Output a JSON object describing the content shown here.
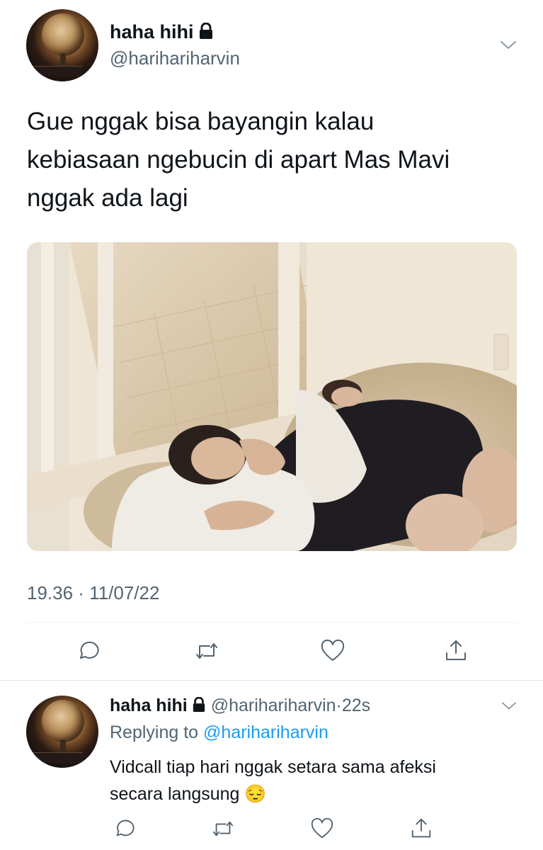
{
  "tweet": {
    "display_name": "haha hihi",
    "handle": "@harihariharvin",
    "text_lines": [
      "Gue nggak bisa bayangin kalau",
      "kebiasaan ngebucin di apart Mas Mavi",
      "nggak ada lagi"
    ],
    "timestamp": "19.36 · 11/07/22",
    "icons": {
      "lock": "lock-icon",
      "more": "chevron-down-icon",
      "reply": "reply-icon",
      "retweet": "retweet-icon",
      "like": "heart-icon",
      "share": "share-icon"
    }
  },
  "reply": {
    "display_name": "haha hihi",
    "handle": "@harihariharvin",
    "separator": "·",
    "time_ago": "22s",
    "replying_prefix": "Replying to",
    "replying_handle": "@harihariharvin",
    "text_lines": [
      "Vidcall tiap hari nggak setara sama afeksi",
      "secara langsung 😔"
    ]
  },
  "colors": {
    "text": "#0f1419",
    "secondary": "#536471",
    "link": "#1d9bf0",
    "divider": "#eff3f4"
  }
}
